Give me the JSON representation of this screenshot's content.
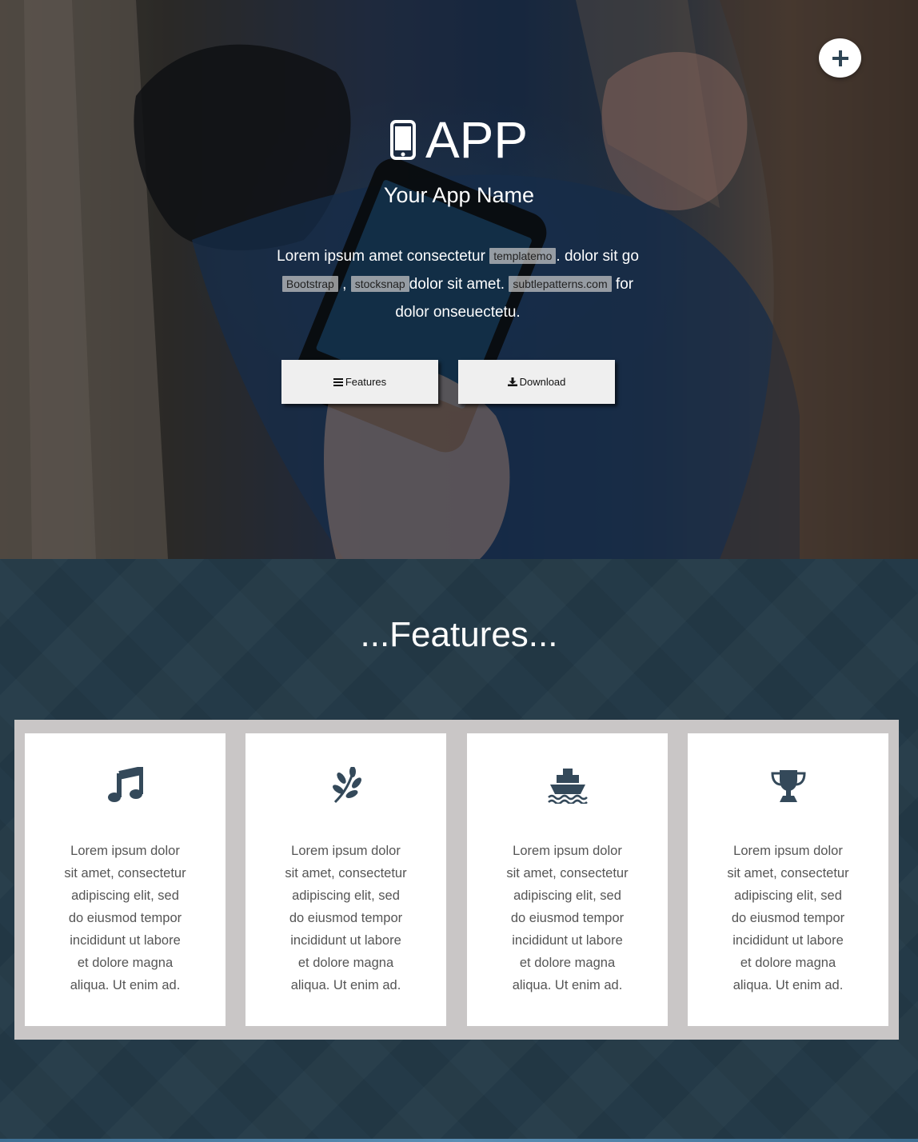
{
  "hero": {
    "title": "APP",
    "title_icon": "mobile-phone-icon",
    "subtitle": "Your App Name",
    "text_parts": {
      "p1": "Lorem ipsum amet consectetur ",
      "chip1": "templatemo",
      "p2": ". dolor sit go ",
      "chip2": "Bootstrap",
      "p3": " , ",
      "chip3": "stocksnap",
      "p4": "dolor sit amet. ",
      "chip4": "subtlepatterns.com",
      "p5": " for dolor onseuectetu."
    },
    "buttons": {
      "features_label": "Features",
      "features_icon": "list-icon",
      "download_label": "Download",
      "download_icon": "download-icon"
    },
    "menu_button_icon": "plus-icon"
  },
  "features": {
    "heading": "...Features...",
    "cards": [
      {
        "icon": "music-note-icon",
        "text": "Lorem ipsum dolor sit amet, consectetur adipiscing elit, sed do eiusmod tempor incididunt ut labore et dolore magna aliqua. Ut enim ad."
      },
      {
        "icon": "leaf-icon",
        "text": "Lorem ipsum dolor sit amet, consectetur adipiscing elit, sed do eiusmod tempor incididunt ut labore et dolore magna aliqua. Ut enim ad."
      },
      {
        "icon": "ship-icon",
        "text": "Lorem ipsum dolor sit amet, consectetur adipiscing elit, sed do eiusmod tempor incididunt ut labore et dolore magna aliqua. Ut enim ad."
      },
      {
        "icon": "trophy-icon",
        "text": "Lorem ipsum dolor sit amet, consectetur adipiscing elit, sed do eiusmod tempor incididunt ut labore et dolore magna aliqua. Ut enim ad."
      }
    ]
  },
  "colors": {
    "features_bg": "#243a48",
    "card_frame": "#c9c6c6",
    "icon_color": "#34495a",
    "button_bg": "#efefef"
  }
}
